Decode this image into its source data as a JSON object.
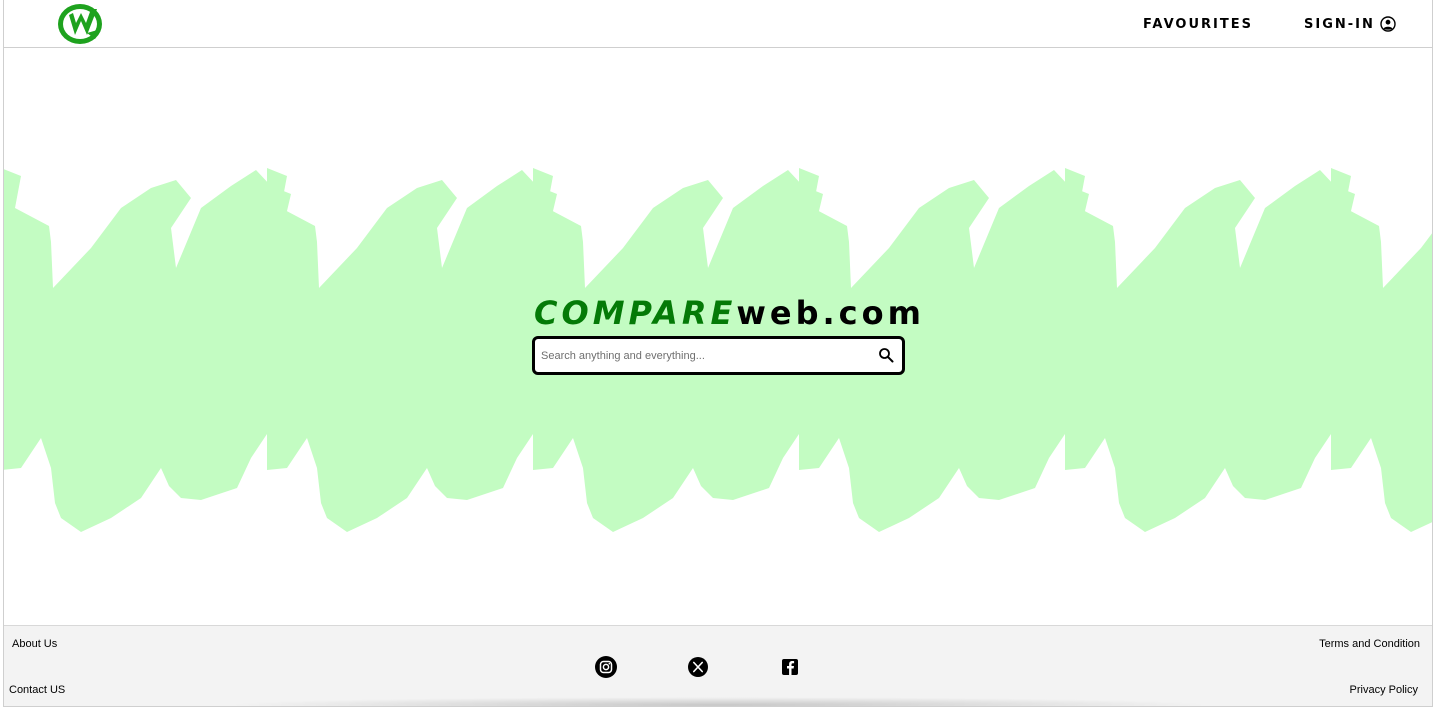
{
  "header": {
    "logo_icon": "cw-logo-icon",
    "nav": {
      "favourites_label": "FAVOURITES",
      "signin_label": "SIGN-IN",
      "signin_icon": "user-circle-icon"
    }
  },
  "hero": {
    "brand_part1": "COMPARE",
    "brand_part2": "web.com",
    "search": {
      "placeholder": "Search anything and everything...",
      "value": "",
      "icon": "search-icon"
    },
    "background_color": "#c3fcc2"
  },
  "footer": {
    "about_label": "About Us",
    "contact_label": "Contact US",
    "terms_label": "Terms and Condition",
    "privacy_label": "Privacy Policy",
    "social_icons": [
      "instagram-icon",
      "x-icon",
      "facebook-icon"
    ]
  },
  "colors": {
    "brand_green": "#047a07",
    "logo_green": "#1ea21e",
    "brush_green": "#c3fcc2",
    "footer_bg": "#f3f3f3"
  }
}
